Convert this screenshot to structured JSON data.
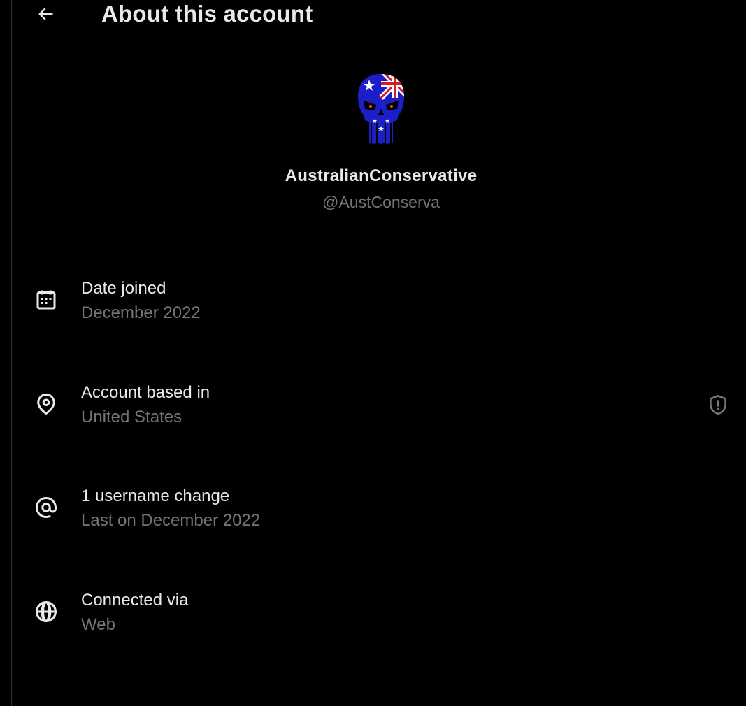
{
  "header": {
    "title": "About this account",
    "back_icon": "arrow-left-icon"
  },
  "profile": {
    "display_name": "AustralianConservative",
    "handle": "@AustConserva",
    "avatar_icon": "punisher-skull-australian-flag-avatar"
  },
  "info": [
    {
      "icon": "calendar-icon",
      "label": "Date joined",
      "value": "December 2022"
    },
    {
      "icon": "location-pin-icon",
      "label": "Account based in",
      "value": "United States",
      "trailing_icon": "shield-alert-icon"
    },
    {
      "icon": "at-sign-icon",
      "label": "1 username change",
      "value": "Last on December 2022"
    },
    {
      "icon": "globe-icon",
      "label": "Connected via",
      "value": "Web"
    }
  ],
  "colors": {
    "background": "#000000",
    "primary_text": "#e7e9ea",
    "secondary_text": "#71767b",
    "divider": "#2f3336"
  }
}
